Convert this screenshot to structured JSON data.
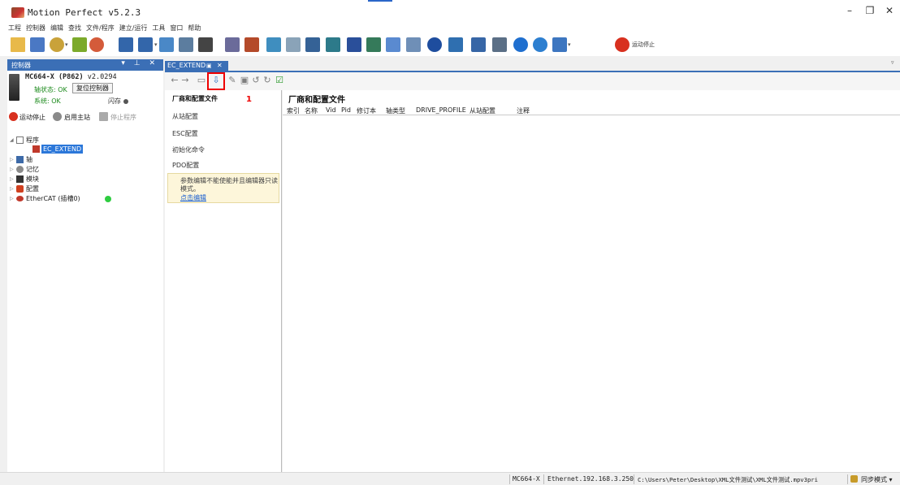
{
  "window": {
    "title": "Motion Perfect v5.2.3",
    "minimize": "–",
    "maximize": "❐",
    "close": "✕"
  },
  "menu": [
    "工程",
    "控制器",
    "编辑",
    "查找",
    "文件/程序",
    "建立/运行",
    "工具",
    "窗口",
    "帮助"
  ],
  "toolbar": {
    "stop_label": "运动停止"
  },
  "left_panel": {
    "header": "控制器",
    "header_icons": "▾ ⊥ ✕",
    "controller_model": "MC664-X (P862)",
    "controller_version": "v2.0294",
    "axis_status": "轴状态: OK",
    "reset_button": "复位控制器",
    "system_status": "系统: OK",
    "flash_label": "闪存",
    "actions": {
      "motion_stop": "运动停止",
      "enable_master": "启用主站",
      "stop_program": "停止程序"
    },
    "tree": [
      {
        "label": "程序",
        "indent": 0,
        "expanded": true
      },
      {
        "label": "EC_EXTEND",
        "indent": 1,
        "selected": true
      },
      {
        "label": "轴",
        "indent": 0
      },
      {
        "label": "记忆",
        "indent": 0
      },
      {
        "label": "模块",
        "indent": 0
      },
      {
        "label": "配置",
        "indent": 0
      },
      {
        "label": "EtherCAT (插槽0)",
        "indent": 0,
        "status_color": "#2ecc40"
      }
    ]
  },
  "editor": {
    "tab_label": "EC_EXTEND",
    "tab_pin": "▣",
    "tab_close": "✕",
    "toolbar_icons": [
      "←",
      "→",
      "▭",
      "⇩",
      "✎",
      "▣",
      "↺",
      "↻",
      "☑"
    ],
    "nav": {
      "items": [
        "厂商和配置文件",
        "从站配置",
        "ESC配置",
        "初始化命令",
        "PDO配置"
      ],
      "annotation": "1",
      "note_text": "参数编辑不能使能并且编辑器只读模式。",
      "note_link": "点击编辑"
    },
    "main_title": "厂商和配置文件",
    "columns": [
      "索引",
      "名称",
      "Vid",
      "Pid",
      "修订本",
      "轴类型",
      "DRIVE_PROFILE",
      "从站配置",
      "注释"
    ]
  },
  "statusbar": {
    "controller": "MC664-X",
    "connection": "Ethernet.192.168.3.250",
    "path": "C:\\Users\\Peter\\Desktop\\XML文件测试\\XML文件测试.mpv3pri",
    "sync": "同步模式 ▾"
  },
  "colors": {
    "panel_header": "#3b6fb6",
    "selected": "#2b77d9",
    "highlight_box": "#e00000",
    "ok_text": "#1b8a1b"
  }
}
